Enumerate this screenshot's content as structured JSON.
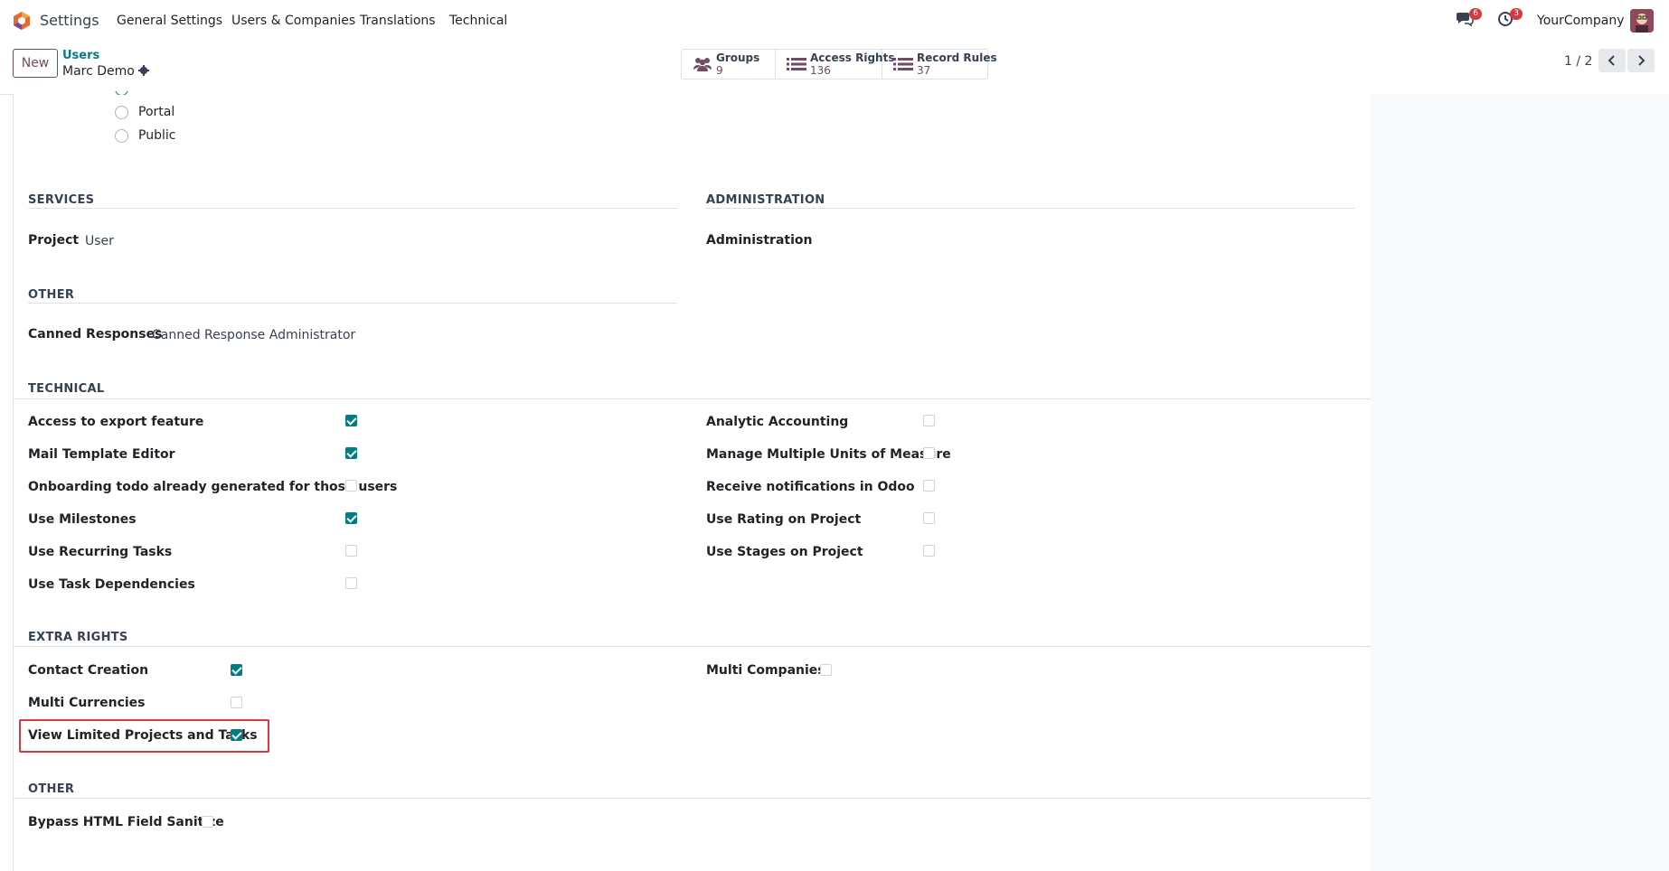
{
  "navbar": {
    "app_name": "Settings",
    "menu": [
      "General Settings",
      "Users & Companies",
      "Translations",
      "Technical"
    ],
    "messages_badge": "6",
    "activities_badge": "3",
    "company": "YourCompany",
    "brand_color": "#714b67",
    "accent_color": "#017e84"
  },
  "control_panel": {
    "new_label": "New",
    "breadcrumb_parent": "Users",
    "breadcrumb_current": "Marc Demo",
    "stats": [
      {
        "label": "Groups",
        "count": "9",
        "icon": "users-icon"
      },
      {
        "label": "Access Rights",
        "count": "136",
        "icon": "list-icon"
      },
      {
        "label": "Record Rules",
        "count": "37",
        "icon": "list-icon"
      }
    ],
    "pager": "1 / 2"
  },
  "user_types": [
    "Portal",
    "Public"
  ],
  "sections": {
    "services": {
      "title": "SERVICES",
      "project_label": "Project",
      "project_value": "User"
    },
    "administration": {
      "title": "ADMINISTRATION",
      "label": "Administration"
    },
    "other": {
      "title": "OTHER",
      "canned_label": "Canned Responses",
      "canned_value": "Canned Response Administrator"
    },
    "technical": {
      "title": "TECHNICAL",
      "left": [
        {
          "label": "Access to export feature",
          "checked": true
        },
        {
          "label": "Mail Template Editor",
          "checked": true
        },
        {
          "label": "Onboarding todo already generated for those users",
          "checked": false
        },
        {
          "label": "Use Milestones",
          "checked": true
        },
        {
          "label": "Use Recurring Tasks",
          "checked": false
        },
        {
          "label": "Use Task Dependencies",
          "checked": false
        }
      ],
      "right": [
        {
          "label": "Analytic Accounting",
          "checked": false
        },
        {
          "label": "Manage Multiple Units of Measure",
          "checked": false
        },
        {
          "label": "Receive notifications in Odoo",
          "checked": false
        },
        {
          "label": "Use Rating on Project",
          "checked": false
        },
        {
          "label": "Use Stages on Project",
          "checked": false
        }
      ]
    },
    "extra_rights": {
      "title": "EXTRA RIGHTS",
      "left": [
        {
          "label": "Contact Creation",
          "checked": true
        },
        {
          "label": "Multi Currencies",
          "checked": false
        },
        {
          "label": "View Limited Projects and Tasks",
          "checked": true
        }
      ],
      "right": [
        {
          "label": "Multi Companies",
          "checked": false
        }
      ]
    },
    "other2": {
      "title": "OTHER",
      "items": [
        {
          "label": "Bypass HTML Field Sanitize",
          "checked": false
        }
      ]
    }
  }
}
